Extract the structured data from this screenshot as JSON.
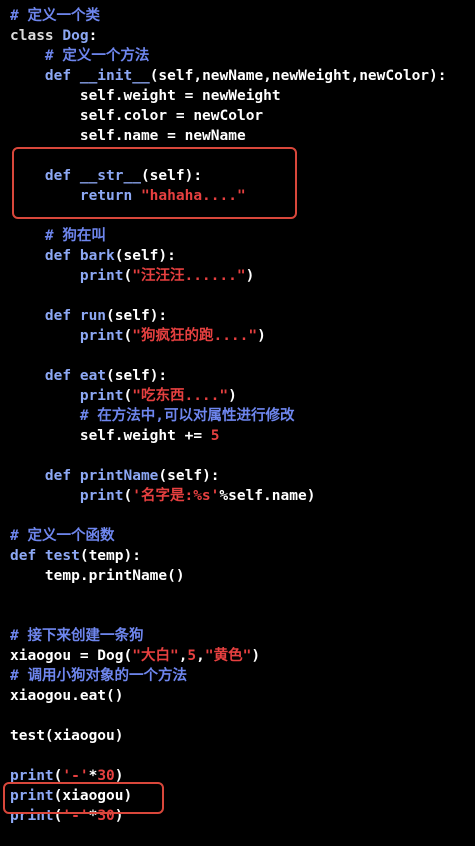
{
  "colors": {
    "background": "#000000",
    "text": "#ffffff",
    "keyword": "#8da8f4",
    "string": "#e64040",
    "comment": "#6e86ee",
    "highlight_box": "#d9473b"
  },
  "code_lines": [
    [
      {
        "t": "# 定义一个类",
        "c": "cm"
      }
    ],
    [
      {
        "t": "class ",
        "c": "kw"
      },
      {
        "t": "Dog",
        "c": "fn"
      },
      {
        "t": ":",
        "c": ""
      }
    ],
    [
      {
        "t": "    ",
        "c": ""
      },
      {
        "t": "# 定义一个方法",
        "c": "cm"
      }
    ],
    [
      {
        "t": "    ",
        "c": ""
      },
      {
        "t": "def ",
        "c": "kb"
      },
      {
        "t": "__init__",
        "c": "fn"
      },
      {
        "t": "(self,newName,newWeight,newColor):",
        "c": ""
      }
    ],
    [
      {
        "t": "        self.weight = newWeight",
        "c": ""
      }
    ],
    [
      {
        "t": "        self.color = newColor",
        "c": ""
      }
    ],
    [
      {
        "t": "        self.name = newName",
        "c": ""
      }
    ],
    [],
    [
      {
        "t": "    ",
        "c": ""
      },
      {
        "t": "def ",
        "c": "kb"
      },
      {
        "t": "__str__",
        "c": "fn"
      },
      {
        "t": "(self):",
        "c": ""
      }
    ],
    [
      {
        "t": "        ",
        "c": ""
      },
      {
        "t": "return ",
        "c": "kb"
      },
      {
        "t": "\"hahaha....\"",
        "c": "str"
      }
    ],
    [],
    [
      {
        "t": "    ",
        "c": ""
      },
      {
        "t": "# 狗在叫",
        "c": "cm"
      }
    ],
    [
      {
        "t": "    ",
        "c": ""
      },
      {
        "t": "def ",
        "c": "kb"
      },
      {
        "t": "bark",
        "c": "fn"
      },
      {
        "t": "(self):",
        "c": ""
      }
    ],
    [
      {
        "t": "        ",
        "c": ""
      },
      {
        "t": "print",
        "c": "kb"
      },
      {
        "t": "(",
        "c": ""
      },
      {
        "t": "\"汪汪汪......\"",
        "c": "str"
      },
      {
        "t": ")",
        "c": ""
      }
    ],
    [],
    [
      {
        "t": "    ",
        "c": ""
      },
      {
        "t": "def ",
        "c": "kb"
      },
      {
        "t": "run",
        "c": "fn"
      },
      {
        "t": "(self):",
        "c": ""
      }
    ],
    [
      {
        "t": "        ",
        "c": ""
      },
      {
        "t": "print",
        "c": "kb"
      },
      {
        "t": "(",
        "c": ""
      },
      {
        "t": "\"狗疯狂的跑....\"",
        "c": "str"
      },
      {
        "t": ")",
        "c": ""
      }
    ],
    [],
    [
      {
        "t": "    ",
        "c": ""
      },
      {
        "t": "def ",
        "c": "kb"
      },
      {
        "t": "eat",
        "c": "fn"
      },
      {
        "t": "(self):",
        "c": ""
      }
    ],
    [
      {
        "t": "        ",
        "c": ""
      },
      {
        "t": "print",
        "c": "kb"
      },
      {
        "t": "(",
        "c": ""
      },
      {
        "t": "\"吃东西....\"",
        "c": "str"
      },
      {
        "t": ")",
        "c": ""
      }
    ],
    [
      {
        "t": "        ",
        "c": ""
      },
      {
        "t": "# 在方法中,可以对属性进行修改",
        "c": "cm"
      }
    ],
    [
      {
        "t": "        self.weight += ",
        "c": ""
      },
      {
        "t": "5",
        "c": "num"
      }
    ],
    [],
    [
      {
        "t": "    ",
        "c": ""
      },
      {
        "t": "def ",
        "c": "kb"
      },
      {
        "t": "printName",
        "c": "fn"
      },
      {
        "t": "(self):",
        "c": ""
      }
    ],
    [
      {
        "t": "        ",
        "c": ""
      },
      {
        "t": "print",
        "c": "kb"
      },
      {
        "t": "(",
        "c": ""
      },
      {
        "t": "'名字是:%s'",
        "c": "str"
      },
      {
        "t": "%self.name)",
        "c": ""
      }
    ],
    [],
    [
      {
        "t": "# 定义一个函数",
        "c": "cm"
      }
    ],
    [
      {
        "t": "def ",
        "c": "kb"
      },
      {
        "t": "test",
        "c": "fn"
      },
      {
        "t": "(temp):",
        "c": ""
      }
    ],
    [
      {
        "t": "    temp.printName()",
        "c": ""
      }
    ],
    [],
    [],
    [
      {
        "t": "# 接下来创建一条狗",
        "c": "cm"
      }
    ],
    [
      {
        "t": "xiaogou = Dog(",
        "c": ""
      },
      {
        "t": "\"大白\"",
        "c": "str"
      },
      {
        "t": ",",
        "c": ""
      },
      {
        "t": "5",
        "c": "num"
      },
      {
        "t": ",",
        "c": ""
      },
      {
        "t": "\"黄色\"",
        "c": "str"
      },
      {
        "t": ")",
        "c": ""
      }
    ],
    [
      {
        "t": "# 调用小狗对象的一个方法",
        "c": "cm"
      }
    ],
    [
      {
        "t": "xiaogou.eat()",
        "c": ""
      }
    ],
    [],
    [
      {
        "t": "test(xiaogou)",
        "c": ""
      }
    ],
    [],
    [
      {
        "t": "print",
        "c": "kb"
      },
      {
        "t": "(",
        "c": ""
      },
      {
        "t": "'-'",
        "c": "str"
      },
      {
        "t": "*",
        "c": ""
      },
      {
        "t": "30",
        "c": "num"
      },
      {
        "t": ")",
        "c": ""
      }
    ],
    [
      {
        "t": "print",
        "c": "kb"
      },
      {
        "t": "(xiaogou)",
        "c": ""
      }
    ],
    [
      {
        "t": "print",
        "c": "kb"
      },
      {
        "t": "(",
        "c": ""
      },
      {
        "t": "'-'",
        "c": "str"
      },
      {
        "t": "*",
        "c": ""
      },
      {
        "t": "30",
        "c": "num"
      },
      {
        "t": ")",
        "c": ""
      }
    ]
  ]
}
